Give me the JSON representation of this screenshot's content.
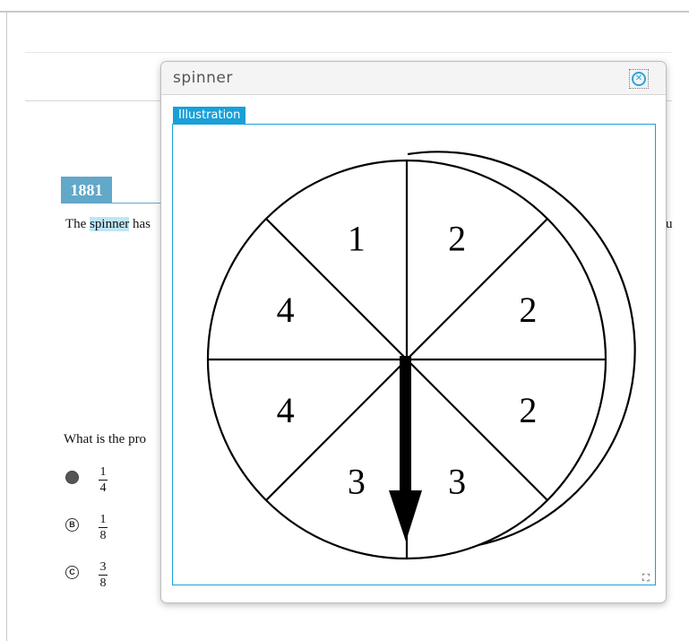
{
  "item": {
    "number": "1881"
  },
  "stem": {
    "prefix": "The ",
    "highlight": "spinner",
    "suffix": " has",
    "right_fragment": "u"
  },
  "question": {
    "text": "What is the pro"
  },
  "choices": [
    {
      "letter": "A",
      "numerator": "1",
      "denominator": "4",
      "selected": true
    },
    {
      "letter": "B",
      "numerator": "1",
      "denominator": "8",
      "selected": false
    },
    {
      "letter": "C",
      "numerator": "3",
      "denominator": "8",
      "selected": false
    }
  ],
  "panel": {
    "title": "spinner",
    "close_icon": "close-circle-icon",
    "tab_label": "Illustration",
    "expand_icon": "expand-icon"
  },
  "spinner": {
    "sections": [
      "2",
      "2",
      "2",
      "3",
      "3",
      "4",
      "4",
      "1"
    ],
    "pointer_section": "3"
  },
  "colors": {
    "accent": "#1aa0d8",
    "badge": "#62a8c9",
    "highlight": "#bfe6f6"
  }
}
